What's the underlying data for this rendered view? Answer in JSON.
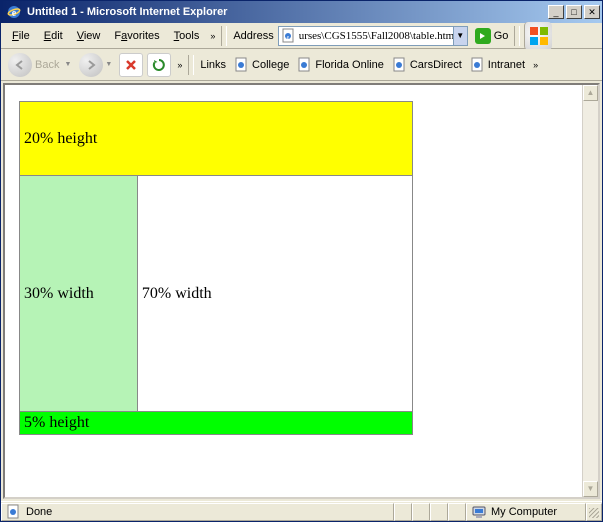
{
  "window": {
    "title": "Untitled 1 - Microsoft Internet Explorer"
  },
  "menu": {
    "file": "File",
    "edit": "Edit",
    "view": "View",
    "favorites": "Favorites",
    "tools": "Tools"
  },
  "address": {
    "label": "Address",
    "value": "urses\\CGS1555\\Fall2008\\table.htm",
    "go": "Go"
  },
  "nav": {
    "back": "Back"
  },
  "links": {
    "label": "Links",
    "items": [
      "College",
      "Florida Online",
      "CarsDirect",
      "Intranet"
    ]
  },
  "table": {
    "r1text": "20% height",
    "r2c1": "30% width",
    "r2c2": "70% width",
    "r3text": "5% height"
  },
  "status": {
    "left": "Done",
    "zone": "My Computer"
  }
}
